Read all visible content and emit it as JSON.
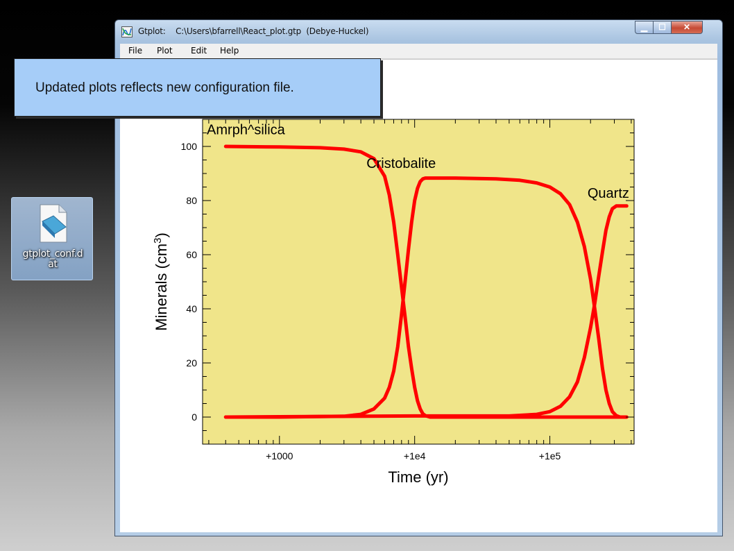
{
  "window": {
    "title": "Gtplot:    C:\\Users\\bfarrell\\React_plot.gtp  (Debye-Huckel)",
    "controls": {
      "minimize": "▁",
      "maximize": "☐",
      "close": "✕"
    },
    "menu": [
      "File",
      "Plot",
      "Edit",
      "Help"
    ]
  },
  "callout": {
    "text": "Updated plots reflects new configuration file."
  },
  "desktop": {
    "icon_label_line1": "gtplot_conf.d",
    "icon_label_line2": "at",
    "icon": "notepad-document-icon"
  },
  "colors": {
    "plot_bg": "#f0e58a",
    "series": "#ff0000",
    "callout": "#a6cdf8"
  },
  "chart_data": {
    "type": "line",
    "xlabel": "Time (yr)",
    "ylabel_main": "Minerals (cm",
    "ylabel_sup": "3",
    "ylabel_close": ")",
    "xscale": "log",
    "xlim": [
      270,
      420000
    ],
    "ylim": [
      -10,
      110
    ],
    "xticks": [
      {
        "value": 1000,
        "label": "+1000"
      },
      {
        "value": 10000,
        "label": "+1e4"
      },
      {
        "value": 100000,
        "label": "+1e5"
      }
    ],
    "yticks": [
      0,
      20,
      40,
      60,
      80,
      100
    ],
    "annotations": [
      {
        "text": "Amrph^silica",
        "x": 290,
        "y": 104.5
      },
      {
        "text": "Cristobalite",
        "x": 4400,
        "y": 92
      },
      {
        "text": "Quartz",
        "x": 190000,
        "y": 81
      }
    ],
    "series": [
      {
        "x": [
          400,
          1000,
          2000,
          3000,
          4000,
          5000,
          6000,
          6500,
          7000,
          7500,
          8000,
          8500,
          9000,
          9500,
          10000,
          10500,
          11000,
          11500,
          12000,
          13000,
          20000,
          100000,
          370000
        ],
        "y": [
          100,
          99.8,
          99.5,
          99,
          98,
          95.5,
          89,
          82,
          72,
          60,
          48,
          37,
          26,
          18,
          11,
          6,
          3,
          1.2,
          0.5,
          0,
          0,
          0,
          0
        ]
      },
      {
        "x": [
          400,
          1000,
          3000,
          4000,
          5000,
          6000,
          6500,
          7000,
          7500,
          8000,
          8500,
          9000,
          9500,
          10000,
          10500,
          11000,
          11500,
          12000,
          13000,
          20000,
          40000,
          60000,
          80000,
          100000,
          120000,
          140000,
          160000,
          180000,
          200000,
          215000,
          230000,
          245000,
          260000,
          275000,
          290000,
          310000,
          330000,
          340000
        ],
        "y": [
          0,
          0,
          0.3,
          1,
          3,
          7,
          11,
          17,
          26,
          38,
          50,
          62,
          72,
          80,
          84.5,
          87,
          88,
          88.3,
          88.3,
          88.3,
          88,
          87.5,
          86.5,
          85,
          82.5,
          78.5,
          72,
          63,
          51,
          40,
          29,
          18,
          10,
          5,
          2,
          0.5,
          0,
          0
        ]
      },
      {
        "x": [
          400,
          10000,
          50000,
          80000,
          100000,
          120000,
          140000,
          160000,
          180000,
          200000,
          215000,
          230000,
          245000,
          260000,
          275000,
          290000,
          310000,
          330000,
          370000
        ],
        "y": [
          0,
          0.4,
          0.4,
          1,
          2,
          4,
          7.5,
          13,
          22,
          33,
          42,
          52,
          61,
          69,
          74,
          77,
          78,
          78,
          78
        ]
      }
    ]
  }
}
